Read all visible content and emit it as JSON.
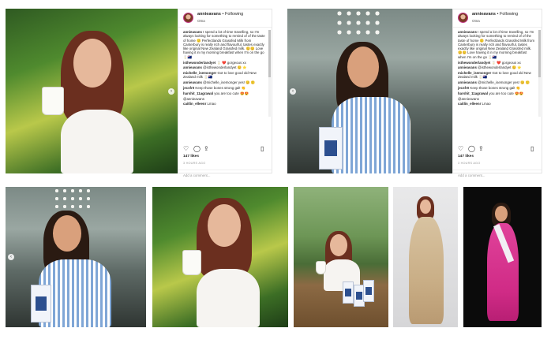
{
  "posts": [
    {
      "username": "annieavans",
      "follow_label": "• Following",
      "location": "Otna",
      "comments": [
        {
          "user": "annieavans",
          "text": "I spend a lot of time travelling, so I'm always looking for something to remind of of the taste of home 🙂 Perfectlands Grassfed Milk from Canterbury is really rich and flavourful, tastes exactly like original New Zealand Grassfed milk. 😊😊 Love having it in my morning breakfast when I'm on the go 🥛🇳🇿"
        },
        {
          "user": "isthewonderlandyet",
          "text": "🥛 ❤️ gorgeous xx"
        },
        {
          "user": "annieavans",
          "text": "@isthewonderlandyet 😊 ⭐"
        },
        {
          "user": "michelle_isemonger",
          "text": "Got to love good old New Zealand milk 🥛🇳🇿"
        },
        {
          "user": "annieavans",
          "text": "@michelle_isemonger yes! 😊 🙂"
        },
        {
          "user": "jecsfr0",
          "text": "Keep those bones strong gal! 👏"
        },
        {
          "user": "harshit_11agrawal",
          "text": "you are too cute 😍😍"
        },
        {
          "user": "",
          "text": "@annieavans"
        },
        {
          "user": "caitlin_elleenr",
          "text": "Lmao"
        }
      ],
      "likes": "147 likes",
      "time": "3 HOURS AGO",
      "add_comment": "Add a comment..."
    },
    {
      "username": "annieavans",
      "follow_label": "• Following",
      "location": "Otna",
      "comments": [
        {
          "user": "annieavans",
          "text": "I spend a lot of time travelling, so I'm always looking for something to remind of of the taste of home 🙂 Perfectlands Grassfed Milk from Canterbury is really rich and flavourful, tastes exactly like original New Zealand Grassfed milk. 😊😊 Love having it in my morning breakfast when I'm on the go 🥛🇳🇿"
        },
        {
          "user": "isthewonderlandyet",
          "text": "🥛 ❤️ gorgeous xx"
        },
        {
          "user": "annieavans",
          "text": "@isthewonderlandyet 😊 ⭐"
        },
        {
          "user": "michelle_isemonger",
          "text": "Got to love good old New Zealand milk 🥛🇳🇿"
        },
        {
          "user": "annieavans",
          "text": "@michelle_isemonger yes! 😊 🙂"
        },
        {
          "user": "jecsfr0",
          "text": "Keep those bones strong gal! 👏"
        },
        {
          "user": "harshit_11agrawal",
          "text": "you are too cute 😍😍"
        },
        {
          "user": "",
          "text": "@annieavans"
        },
        {
          "user": "caitlin_elleenr",
          "text": "Lmao"
        }
      ],
      "likes": "147 likes",
      "time": "3 HOURS AGO",
      "add_comment": "Add a comment..."
    }
  ],
  "icons": {
    "like": "♡",
    "comment": "◯",
    "share": "⇪",
    "save": "▯",
    "prev": "‹",
    "next": "›"
  }
}
